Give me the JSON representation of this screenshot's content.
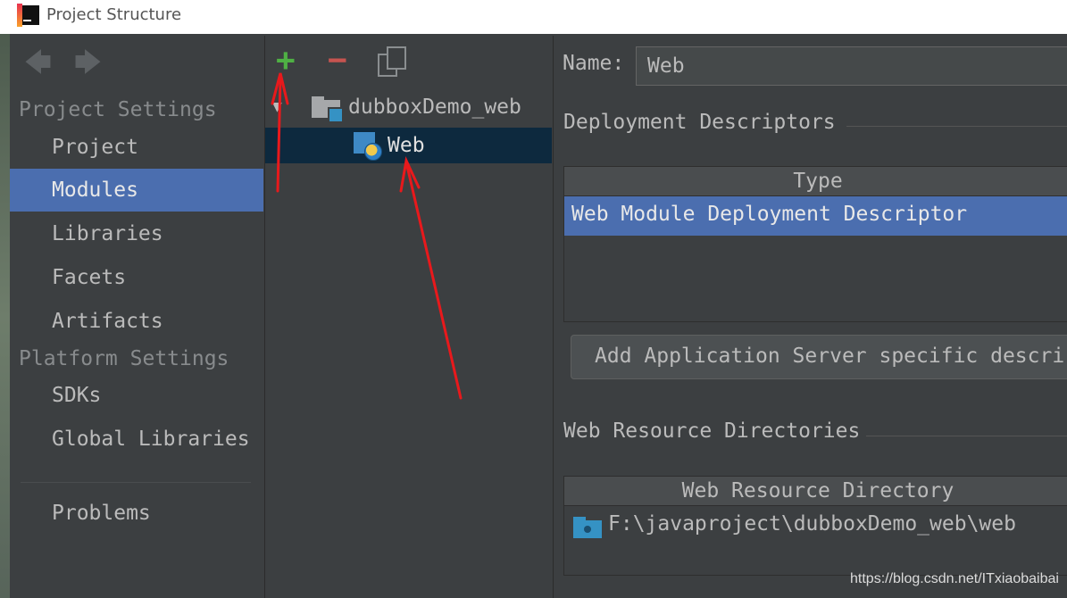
{
  "window": {
    "title": "Project Structure"
  },
  "nav": {
    "back_glyph": "🡄",
    "forward_glyph": "🡆",
    "project_settings_heading": "Project Settings",
    "platform_settings_heading": "Platform Settings",
    "items": {
      "project": "Project",
      "modules": "Modules",
      "libraries": "Libraries",
      "facets": "Facets",
      "artifacts": "Artifacts",
      "sdks": "SDKs",
      "global_libraries": "Global Libraries",
      "problems": "Problems"
    },
    "selected": "Modules"
  },
  "toolbar": {
    "add_glyph": "+",
    "remove_glyph": "−"
  },
  "tree": {
    "expander_glyph": "▼",
    "root_label": "dubboxDemo_web",
    "child_label": "Web"
  },
  "details": {
    "name_label": "Name:",
    "name_value": "Web",
    "deployment_section": "Deployment Descriptors",
    "descriptors_table": {
      "header": "Type",
      "rows": [
        "Web Module Deployment Descriptor"
      ]
    },
    "add_server_button": "Add Application Server specific descri",
    "web_resource_section": "Web Resource Directories",
    "resource_table": {
      "header": "Web Resource Directory",
      "rows": [
        "F:\\javaproject\\dubboxDemo_web\\web"
      ]
    }
  },
  "watermark": "https://blog.csdn.net/ITxiaobaibai",
  "colors": {
    "selection": "#4b6eaf",
    "tree_selection": "#0d293e",
    "add": "#4fb044",
    "remove": "#c75450",
    "annotation": "#e8191c"
  }
}
